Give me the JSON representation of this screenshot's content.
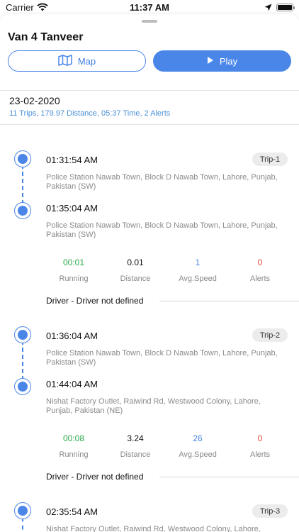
{
  "status_bar": {
    "carrier": "Carrier",
    "time": "11:37 AM"
  },
  "header": {
    "title": "Van 4 Tanveer"
  },
  "buttons": {
    "map_label": "Map",
    "play_label": "Play"
  },
  "day": {
    "date": "23-02-2020",
    "summary": "11 Trips, 179.97 Distance, 05:37 Time, 2 Alerts"
  },
  "trips": [
    {
      "badge": "Trip-1",
      "start_time": "01:31:54 AM",
      "start_address": "Police Station Nawab Town, Block D Nawab Town, Lahore, Punjab, Pakistan (SW)",
      "end_time": "01:35:04 AM",
      "end_address": "Police Station Nawab Town, Block D Nawab Town, Lahore, Punjab, Pakistan (SW)",
      "stats": {
        "running": "00:01",
        "distance": "0.01",
        "avg_speed": "1",
        "alerts": "0"
      },
      "driver": "Driver - Driver not defined"
    },
    {
      "badge": "Trip-2",
      "start_time": "01:36:04 AM",
      "start_address": "Police Station Nawab Town, Block D Nawab Town, Lahore, Punjab, Pakistan (SW)",
      "end_time": "01:44:04 AM",
      "end_address": "Nishat Factory Outlet, Raiwind Rd, Westwood Colony, Lahore, Punjab, Pakistan (NE)",
      "stats": {
        "running": "00:08",
        "distance": "3.24",
        "avg_speed": "26",
        "alerts": "0"
      },
      "driver": "Driver - Driver not defined"
    },
    {
      "badge": "Trip-3",
      "start_time": "02:35:54 AM",
      "start_address": "Nishat Factory Outlet, Raiwind Rd, Westwood Colony, Lahore, Punjab, Pakistan (NE)"
    }
  ],
  "stat_labels": {
    "running": "Running",
    "distance": "Distance",
    "avg_speed": "Avg.Speed",
    "alerts": "Alerts"
  },
  "icons": {
    "map": "map-icon",
    "play": "play-icon",
    "wifi": "wifi-icon",
    "location": "location-arrow-icon",
    "battery": "battery-icon"
  },
  "colors": {
    "accent": "#4a86e8",
    "running": "#2aa84a",
    "avg_speed": "#4a86e8",
    "alerts": "#e04a3a",
    "summary": "#4b8fd6"
  }
}
